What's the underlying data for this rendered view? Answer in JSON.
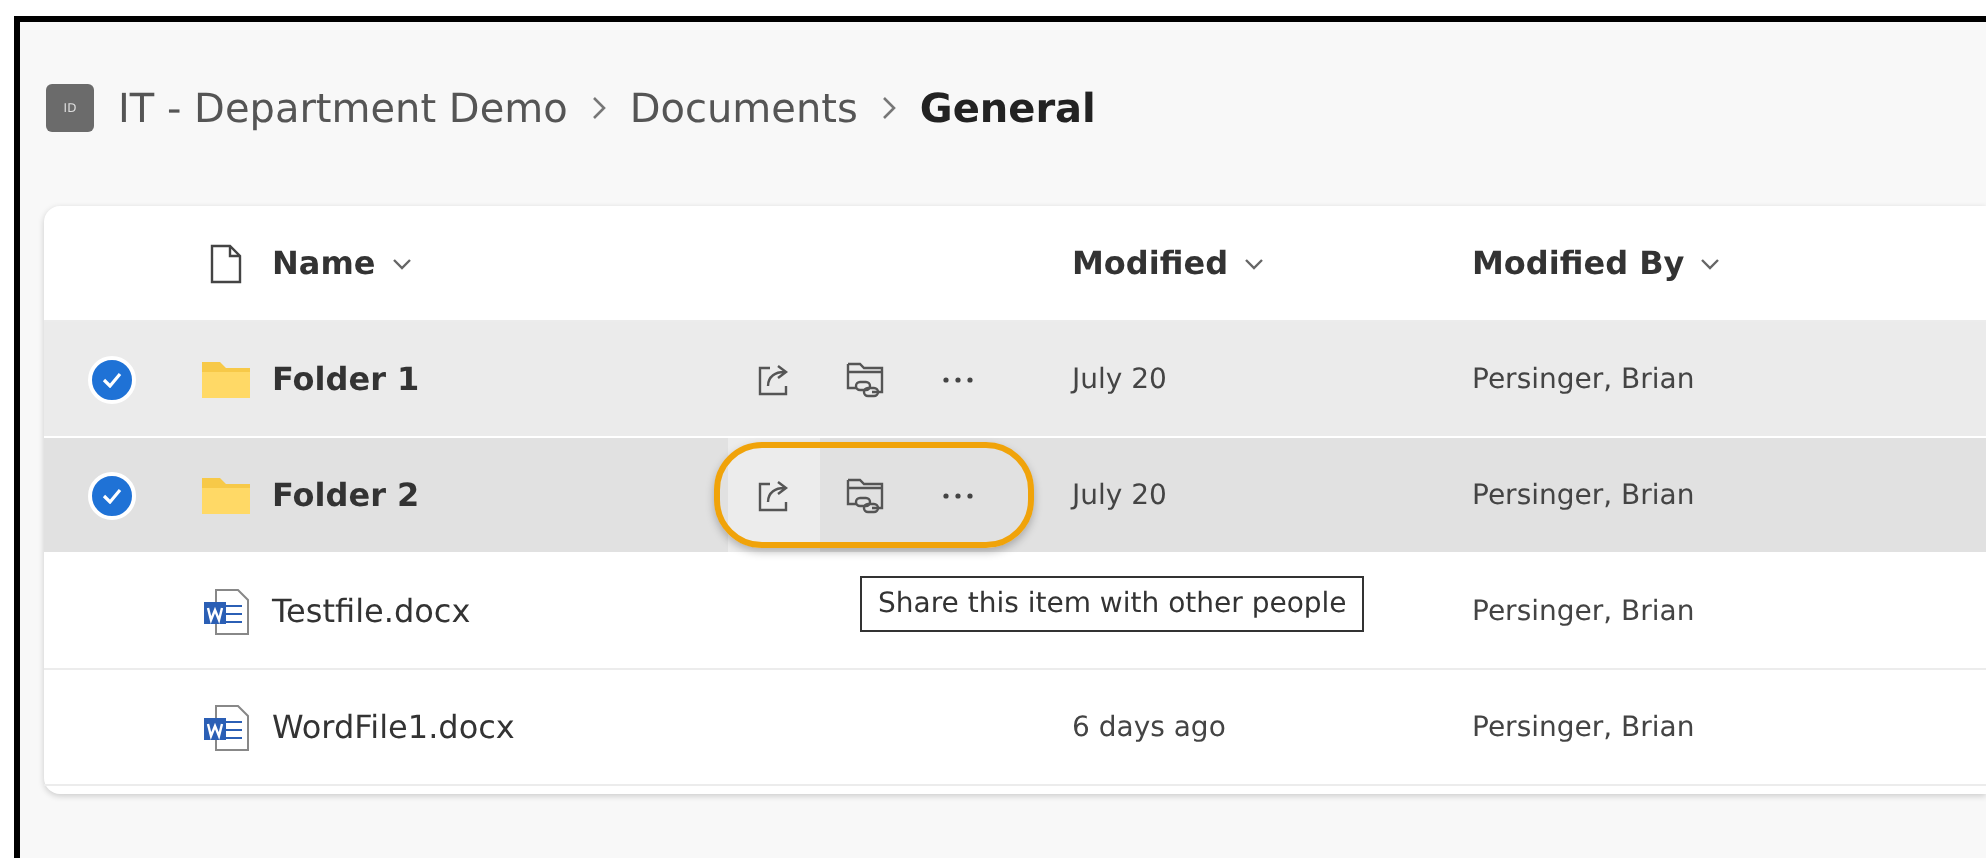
{
  "breadcrumb": [
    {
      "label": "IT - Department Demo",
      "kind": "site",
      "badge": "ID"
    },
    {
      "label": "Documents",
      "kind": "link"
    },
    {
      "label": "General",
      "kind": "current"
    }
  ],
  "table": {
    "columns": [
      {
        "label": "Name"
      },
      {
        "label": "Modified"
      },
      {
        "label": "Modified By"
      }
    ],
    "rows": [
      {
        "kind": "folder",
        "name": "Folder 1",
        "modified": "July 20",
        "modified_by": "Persinger, Brian",
        "selected": true,
        "hovered": false,
        "highlighted": false
      },
      {
        "kind": "folder",
        "name": "Folder 2",
        "modified": "July 20",
        "modified_by": "Persinger, Brian",
        "selected": true,
        "hovered": true,
        "highlighted": true,
        "tooltip": "Share this item with other people"
      },
      {
        "kind": "document",
        "name": "Testfile.docx",
        "modified_by": "Persinger, Brian",
        "selected": false,
        "hovered": false,
        "highlighted": false
      },
      {
        "kind": "document",
        "name": "WordFile1.docx",
        "modified": "6 days ago",
        "modified_by": "Persinger, Brian",
        "selected": false,
        "hovered": false,
        "highlighted": false
      }
    ]
  }
}
